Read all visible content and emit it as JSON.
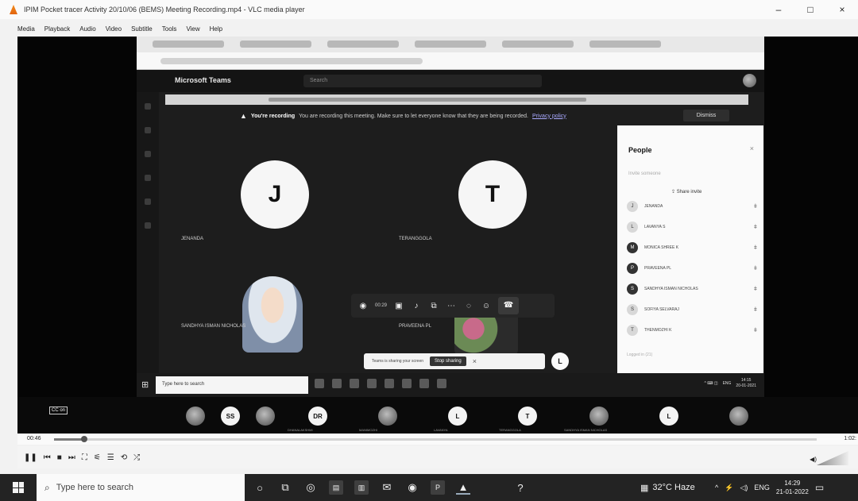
{
  "vlc": {
    "title": "IPIM Pocket tracer Activity 20/10/06 (BEMS) Meeting Recording.mp4 - VLC media player",
    "menu": [
      "Media",
      "Playback",
      "Audio",
      "Video",
      "Subtitle",
      "Tools",
      "View",
      "Help"
    ],
    "window_controls": {
      "minimize": "–",
      "maximize": "□",
      "close": "×"
    },
    "seek": {
      "elapsed": "00:46",
      "duration": "1:02:",
      "progress": 0.04
    }
  },
  "teams": {
    "app_name": "Microsoft Teams",
    "search_placeholder": "Search",
    "recording_notice": {
      "headline": "You're recording",
      "body": "You are recording this meeting. Make sure to let everyone know that they are being recorded.",
      "link": "Privacy policy",
      "dismiss": "Dismiss"
    },
    "tiles": [
      {
        "initial": "J",
        "name": "JENANDA"
      },
      {
        "initial": "T",
        "name": "TERANGGOLA"
      },
      {
        "name": "SANDHYA ISMAN NICHOLAS"
      },
      {
        "name": "PRAVEENA PL"
      }
    ],
    "call_controls": {
      "timer": "00:29",
      "hangup": "☎"
    },
    "sharing_bar": {
      "message": "Teams is sharing your screen",
      "stop": "Stop sharing"
    },
    "floating_bubble": "L",
    "people_panel": {
      "title": "People",
      "invite_placeholder": "Invite someone",
      "share_invite": "Share invite",
      "participants": [
        {
          "initial": "J",
          "name": "JENANDA"
        },
        {
          "initial": "L",
          "name": "LAVANYA S"
        },
        {
          "initial": "M",
          "name": "MONICA SHREE K"
        },
        {
          "initial": "P",
          "name": "PRAVEENA PL"
        },
        {
          "initial": "S",
          "name": "SANDHYA ISMAN NICHOLAS"
        },
        {
          "initial": "S",
          "name": "SOFIYA SELVARAJ"
        },
        {
          "initial": "T",
          "name": "THENMOZHI K"
        }
      ],
      "footer": "Logged in (21)"
    }
  },
  "inner_taskbar": {
    "search_placeholder": "Type here to search",
    "lang": "ENG",
    "time": "14:15",
    "date": "20-01-2021"
  },
  "strip": {
    "cc": "CC on",
    "chips": [
      {
        "label": "",
        "caption": ""
      },
      {
        "label": "SS",
        "caption": ""
      },
      {
        "label": "",
        "caption": ""
      },
      {
        "label": "DR",
        "caption": "DHANALAKSHMI"
      },
      {
        "label": "",
        "caption": "MANIMOZHI"
      },
      {
        "label": "L",
        "caption": "LAVANYA"
      },
      {
        "label": "T",
        "caption": "TERANGGOLA"
      },
      {
        "label": "",
        "caption": "SANDHYA ISMAN NICHOLAS"
      },
      {
        "label": "L",
        "caption": ""
      },
      {
        "label": "",
        "caption": ""
      }
    ]
  },
  "taskbar": {
    "search_placeholder": "Type here to search",
    "weather": "32°C Haze",
    "lang": "ENG",
    "time": "14:29",
    "date": "21-01-2022"
  }
}
